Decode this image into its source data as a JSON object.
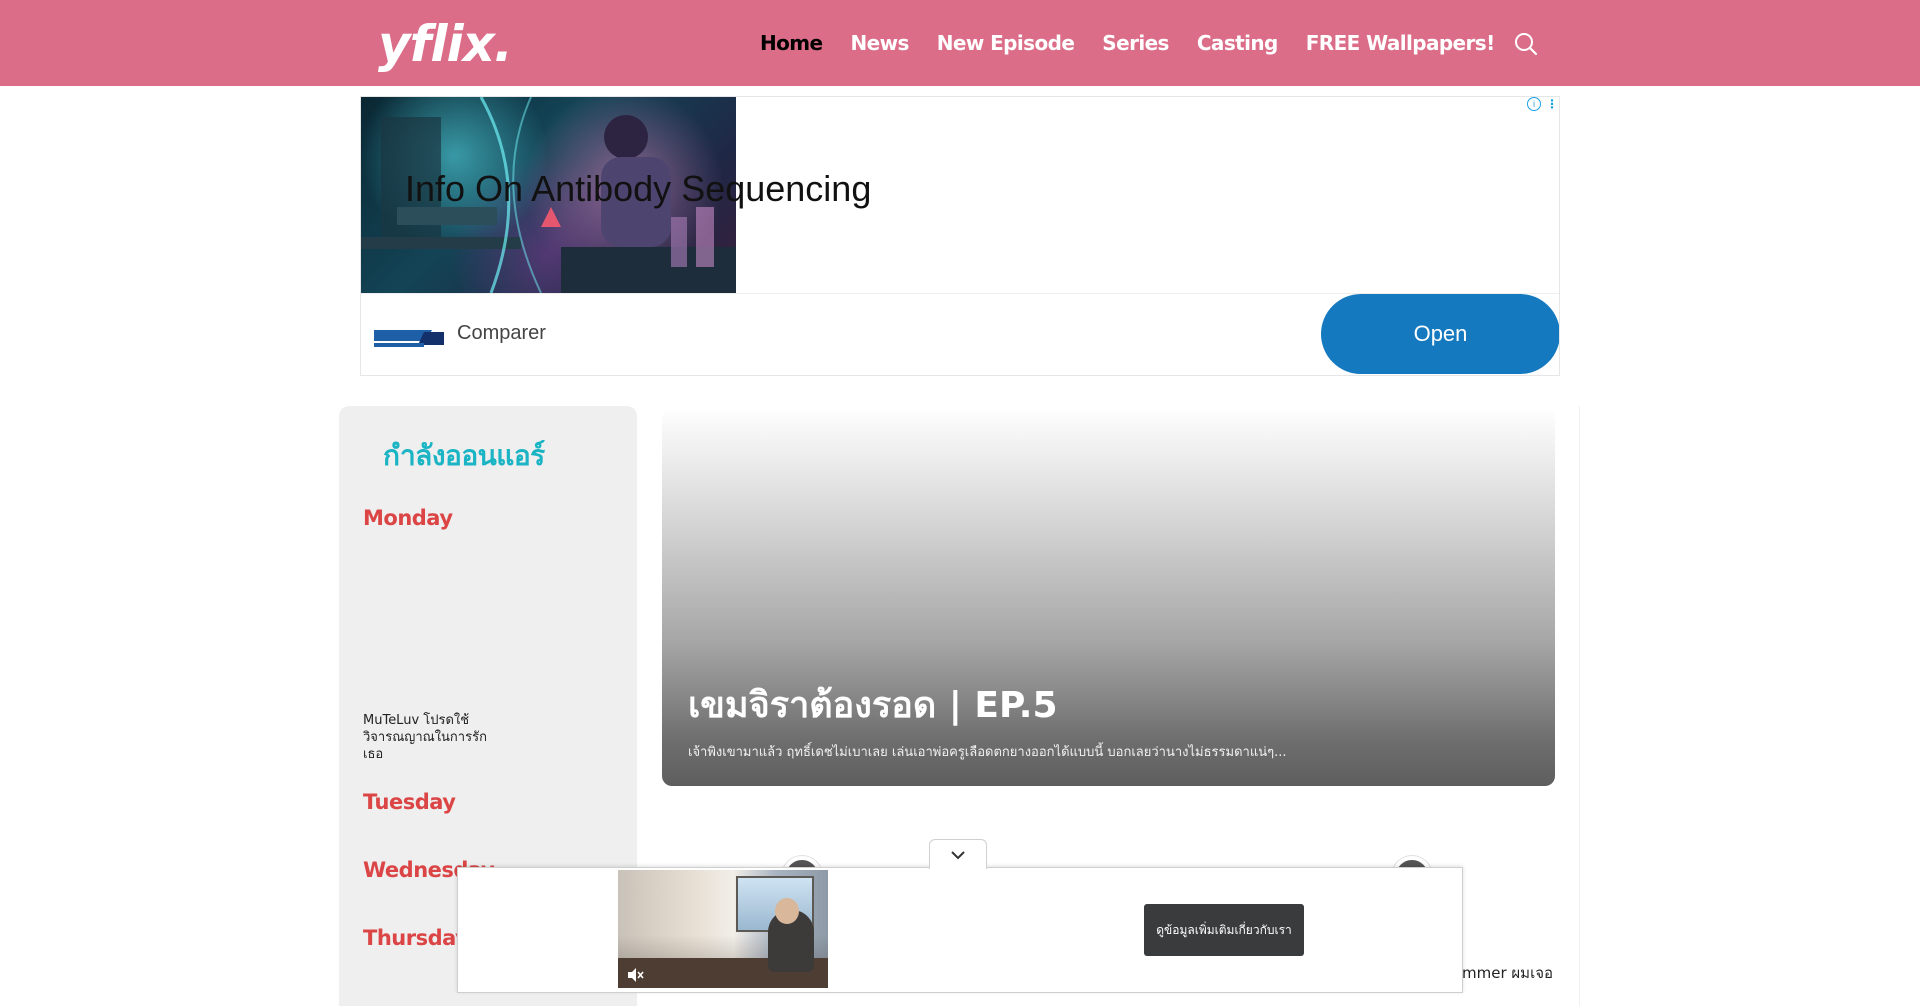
{
  "header": {
    "logo": "yflix.",
    "nav": [
      {
        "label": "Home",
        "active": true
      },
      {
        "label": "News",
        "active": false
      },
      {
        "label": "New Episode",
        "active": false
      },
      {
        "label": "Series",
        "active": false
      },
      {
        "label": "Casting",
        "active": false
      },
      {
        "label": "FREE Wallpapers!",
        "active": false
      }
    ],
    "search_icon": "search-icon",
    "bg_color": "#db6d88"
  },
  "top_ad": {
    "headline": "Info On Antibody Sequencing",
    "brand_logo_text": "COMPARER",
    "brand_logo_suffix": ".co",
    "brand_name": "Comparer",
    "cta": "Open",
    "cta_color": "#1479bf"
  },
  "sidebar": {
    "title": "กำลังออนแอร์",
    "days": [
      {
        "label": "Monday"
      },
      {
        "label": "Tuesday"
      },
      {
        "label": "Wednesday"
      },
      {
        "label": "Thursday"
      }
    ],
    "monday_show": "MuTeLuv โปรดใช้วิจารณญาณในการรักเธอ",
    "title_color": "#1bb4c4",
    "day_color": "#dc4545"
  },
  "featured": {
    "title": "เขมจิราต้องรอด | EP.5",
    "excerpt": "เจ้าพิงเขามาแล้ว ฤทธิ์เดชไม่เบาเลย เล่นเอาพ่อครูเลือดตกยางออกได้แบบนี้ บอกเลยว่านางไม่ธรรมดาแน่ๆ..."
  },
  "partial_text": "mmer ผมเจอ",
  "bottom_ad": {
    "cta": "ดูข้อมูลเพิ่มเติมเกี่ยวกับเรา"
  }
}
